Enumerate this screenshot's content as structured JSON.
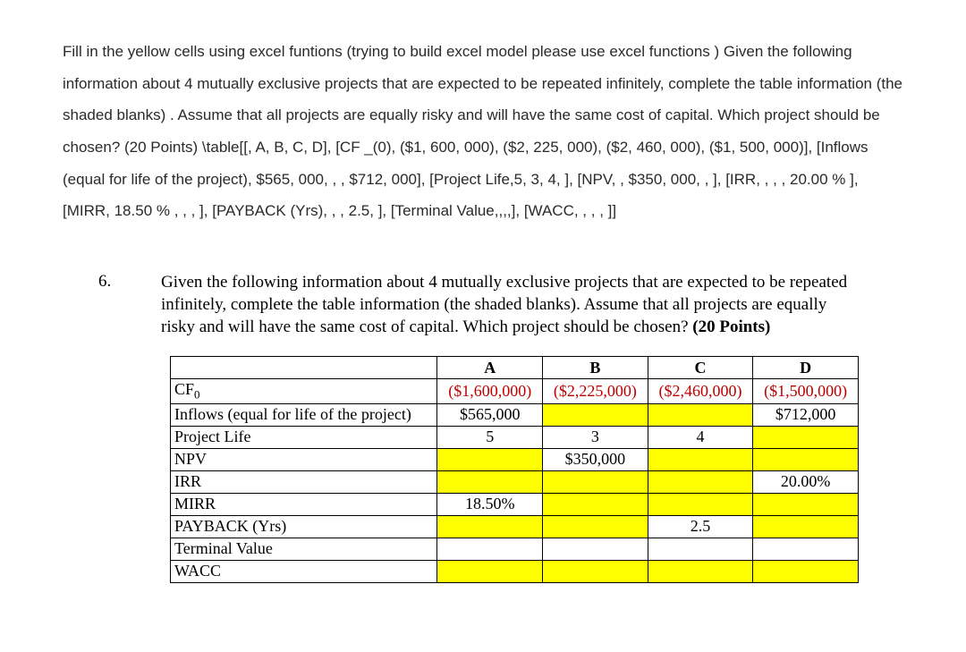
{
  "instructions": "Fill in the yellow cells using excel funtions (trying to build excel model please use excel functions ) Given the following information about 4 mutually exclusive projects that are expected to be repeated infinitely, complete the table information (the shaded blanks) . Assume that all projects are equally risky and will have the same cost of capital. Which project should be chosen? (20 Points) \\table[[, A, B, C, D], [CF _(0), ($1, 600, 000), ($2, 225, 000), ($2, 460, 000), ($1, 500, 000)], [Inflows (equal for life of the project), $565, 000, , , $712, 000], [Project Life,5, 3, 4, ], [NPV, , $350, 000, , ], [IRR, , , , 20.00 % ], [MIRR, 18.50 % , , , ], [PAYBACK (Yrs), , , 2.5, ], [Terminal Value,,,,], [WACC, , , , ]]",
  "question": {
    "number": "6.",
    "text_prefix": "Given the following information about 4 mutually exclusive projects that are expected to be repeated infinitely, complete the table information (the shaded blanks).  Assume that all projects are equally risky and will have the same cost of capital.  Which project should be chosen? ",
    "text_bold": "(20 Points)"
  },
  "table": {
    "headers": [
      "A",
      "B",
      "C",
      "D"
    ],
    "rows": [
      {
        "label": "CF",
        "sub": "0",
        "cells": [
          {
            "value": "($1,600,000)",
            "red": true,
            "yellow": false
          },
          {
            "value": "($2,225,000)",
            "red": true,
            "yellow": false
          },
          {
            "value": "($2,460,000)",
            "red": true,
            "yellow": false
          },
          {
            "value": "($1,500,000)",
            "red": true,
            "yellow": false
          }
        ]
      },
      {
        "label": "Inflows (equal for life of the project)",
        "cells": [
          {
            "value": "$565,000",
            "yellow": false
          },
          {
            "value": "",
            "yellow": true
          },
          {
            "value": "",
            "yellow": true
          },
          {
            "value": "$712,000",
            "yellow": false
          }
        ]
      },
      {
        "label": "Project Life",
        "cells": [
          {
            "value": "5",
            "yellow": false
          },
          {
            "value": "3",
            "yellow": false
          },
          {
            "value": "4",
            "yellow": false
          },
          {
            "value": "",
            "yellow": true
          }
        ]
      },
      {
        "label": "NPV",
        "cells": [
          {
            "value": "",
            "yellow": true
          },
          {
            "value": "$350,000",
            "yellow": false
          },
          {
            "value": "",
            "yellow": true
          },
          {
            "value": "",
            "yellow": true
          }
        ]
      },
      {
        "label": "IRR",
        "cells": [
          {
            "value": "",
            "yellow": true
          },
          {
            "value": "",
            "yellow": true
          },
          {
            "value": "",
            "yellow": true
          },
          {
            "value": "20.00%",
            "yellow": false
          }
        ]
      },
      {
        "label": "MIRR",
        "cells": [
          {
            "value": "18.50%",
            "yellow": false
          },
          {
            "value": "",
            "yellow": true
          },
          {
            "value": "",
            "yellow": true
          },
          {
            "value": "",
            "yellow": true
          }
        ]
      },
      {
        "label": "PAYBACK (Yrs)",
        "cells": [
          {
            "value": "",
            "yellow": true
          },
          {
            "value": "",
            "yellow": true
          },
          {
            "value": "2.5",
            "yellow": false
          },
          {
            "value": "",
            "yellow": true
          }
        ]
      },
      {
        "label": "Terminal Value",
        "cells": [
          {
            "value": "",
            "yellow": false
          },
          {
            "value": "",
            "yellow": false
          },
          {
            "value": "",
            "yellow": false
          },
          {
            "value": "",
            "yellow": false
          }
        ]
      },
      {
        "label": "WACC",
        "cells": [
          {
            "value": "",
            "yellow": true
          },
          {
            "value": "",
            "yellow": true
          },
          {
            "value": "",
            "yellow": true
          },
          {
            "value": "",
            "yellow": true
          }
        ]
      }
    ]
  }
}
